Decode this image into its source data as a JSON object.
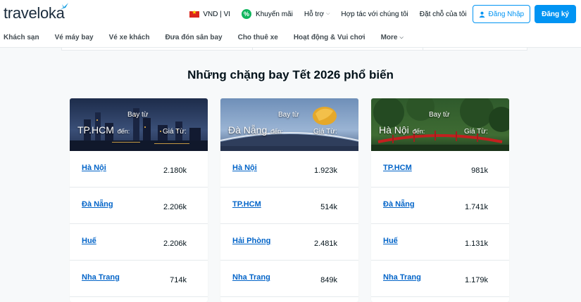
{
  "header": {
    "logo_text": "traveloka",
    "currency_lang": "VND | VI",
    "promo": "Khuyến mãi",
    "support": "Hỗ trợ",
    "partner": "Hợp tác với chúng tôi",
    "bookings": "Đặt chỗ của tôi",
    "login": "Đăng Nhập",
    "signup": "Đăng ký"
  },
  "subnav": {
    "items": [
      "Khách sạn",
      "Vé máy bay",
      "Vé xe khách",
      "Đưa đón sân bay",
      "Cho thuê xe",
      "Hoạt động & Vui chơi",
      "More"
    ]
  },
  "section": {
    "title": "Những chặng bay Tết 2026 phổ biến"
  },
  "cards": [
    {
      "from_label": "Bay từ",
      "city": "TP.HCM",
      "to_label": "đến:",
      "price_label": "Giá Từ:",
      "routes": [
        {
          "dest": "Hà Nội",
          "price": "2.180k"
        },
        {
          "dest": "Đà Nẵng",
          "price": "2.206k"
        },
        {
          "dest": "Huế",
          "price": "2.206k"
        },
        {
          "dest": "Nha Trang",
          "price": "714k"
        }
      ]
    },
    {
      "from_label": "Bay từ",
      "city": "Đà Nẵng",
      "to_label": "đến:",
      "price_label": "Giá Từ:",
      "routes": [
        {
          "dest": "Hà Nội",
          "price": "1.923k"
        },
        {
          "dest": "TP.HCM",
          "price": "514k"
        },
        {
          "dest": "Hải Phòng",
          "price": "2.481k"
        },
        {
          "dest": "Nha Trang",
          "price": "849k"
        }
      ]
    },
    {
      "from_label": "Bay từ",
      "city": "Hà Nội",
      "to_label": "đến:",
      "price_label": "Giá Từ:",
      "routes": [
        {
          "dest": "TP.HCM",
          "price": "981k"
        },
        {
          "dest": "Đà Nẵng",
          "price": "1.741k"
        },
        {
          "dest": "Huế",
          "price": "1.131k"
        },
        {
          "dest": "Nha Trang",
          "price": "1.179k"
        }
      ]
    }
  ],
  "colors": {
    "brand_blue": "#0194f3",
    "link_blue": "#0264c8",
    "promo_green": "#0fb55d"
  }
}
